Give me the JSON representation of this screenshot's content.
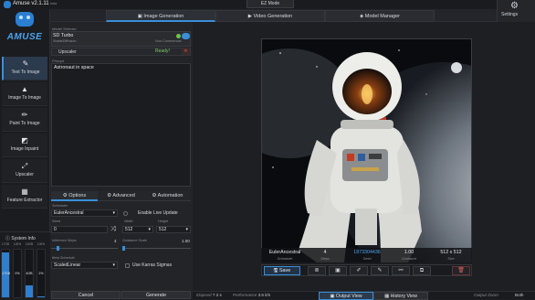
{
  "window": {
    "title": "Amuse v2.1.11",
    "version_tag": "beta",
    "ez_mode_label": "EZ Mode"
  },
  "tabs": [
    {
      "label": "Image Generation",
      "icon": "image-icon",
      "active": true
    },
    {
      "label": "Video Generation",
      "icon": "video-icon",
      "active": false
    },
    {
      "label": "Model Manager",
      "icon": "model-icon",
      "active": false
    }
  ],
  "settings_label": "Settings",
  "logo_text": "AMUSE",
  "sidebar": {
    "items": [
      {
        "label": "Text To Image",
        "icon": "text-to-image-icon",
        "active": true
      },
      {
        "label": "Image To Image",
        "icon": "image-to-image-icon",
        "active": false
      },
      {
        "label": "Paint To Image",
        "icon": "paint-icon",
        "active": false
      },
      {
        "label": "Image Inpaint",
        "icon": "inpaint-icon",
        "active": false
      },
      {
        "label": "Upscaler",
        "icon": "upscaler-icon",
        "active": false
      },
      {
        "label": "Feature Extractor",
        "icon": "feature-extractor-icon",
        "active": false
      }
    ]
  },
  "system_info": {
    "title": "System Info",
    "meters": [
      {
        "label": "17GB",
        "value": "17GB",
        "fill": 0.95
      },
      {
        "label": "100%",
        "value": "0%",
        "fill": 0.0
      },
      {
        "label": "16GB",
        "value": "4GB",
        "fill": 0.25
      },
      {
        "label": "100%",
        "value": "2%",
        "fill": 0.02
      }
    ]
  },
  "model": {
    "label": "Model Selector",
    "name": "SD Turbo",
    "subtitle": "StableDiffusion",
    "license": "Non-Commercial",
    "upscaler_label": "Upscaler",
    "status": "Ready!"
  },
  "prompt": {
    "label": "Prompt",
    "text": "Astronaut in space"
  },
  "option_tabs": [
    {
      "label": "Options",
      "active": true
    },
    {
      "label": "Advanced",
      "active": false
    },
    {
      "label": "Automation",
      "active": false
    }
  ],
  "options": {
    "scheduler_label": "Scheduler",
    "scheduler_value": "EulerAncestral",
    "live_update_label": "Enable Live Update",
    "seed_label": "Seed",
    "seed_value": "0",
    "width_label": "Width",
    "width_value": "512",
    "height_label": "Height",
    "height_value": "512",
    "inference_steps_label": "Inference Steps",
    "inference_steps_value": "4",
    "inference_steps_fraction": 0.08,
    "guidance_scale_label": "Guidance Scale",
    "guidance_scale_value": "1.00",
    "guidance_scale_fraction": 0.0,
    "beta_schedule_label": "Beta Schedule",
    "beta_schedule_value": "ScaledLinear",
    "karras_label": "Use Karras Sigmas"
  },
  "buttons": {
    "cancel": "Cancel",
    "generate": "Generate",
    "save": "Save"
  },
  "result": {
    "scheduler": {
      "value": "EulerAncestral",
      "key": "Scheduler"
    },
    "steps": {
      "value": "4",
      "key": "Steps"
    },
    "seed": {
      "value": "1873304436",
      "key": "Seed"
    },
    "guidance": {
      "value": "1.00",
      "key": "Guidance"
    },
    "size": {
      "value": "512 x 512",
      "key": "Size"
    }
  },
  "status_bar": {
    "elapsed_label": "Elapsed",
    "elapsed_value": "7.2 s",
    "performance_label": "Performance",
    "performance_value": "3.5 it/s",
    "output_view": "Output View",
    "history_view": "History View",
    "output_zoom_label": "Output Zoom",
    "output_zoom_value": "Both"
  },
  "colors": {
    "accent": "#3a8fd9",
    "ready": "#7cd06a",
    "danger": "#e06060",
    "seed_link": "#4aa3ee"
  }
}
